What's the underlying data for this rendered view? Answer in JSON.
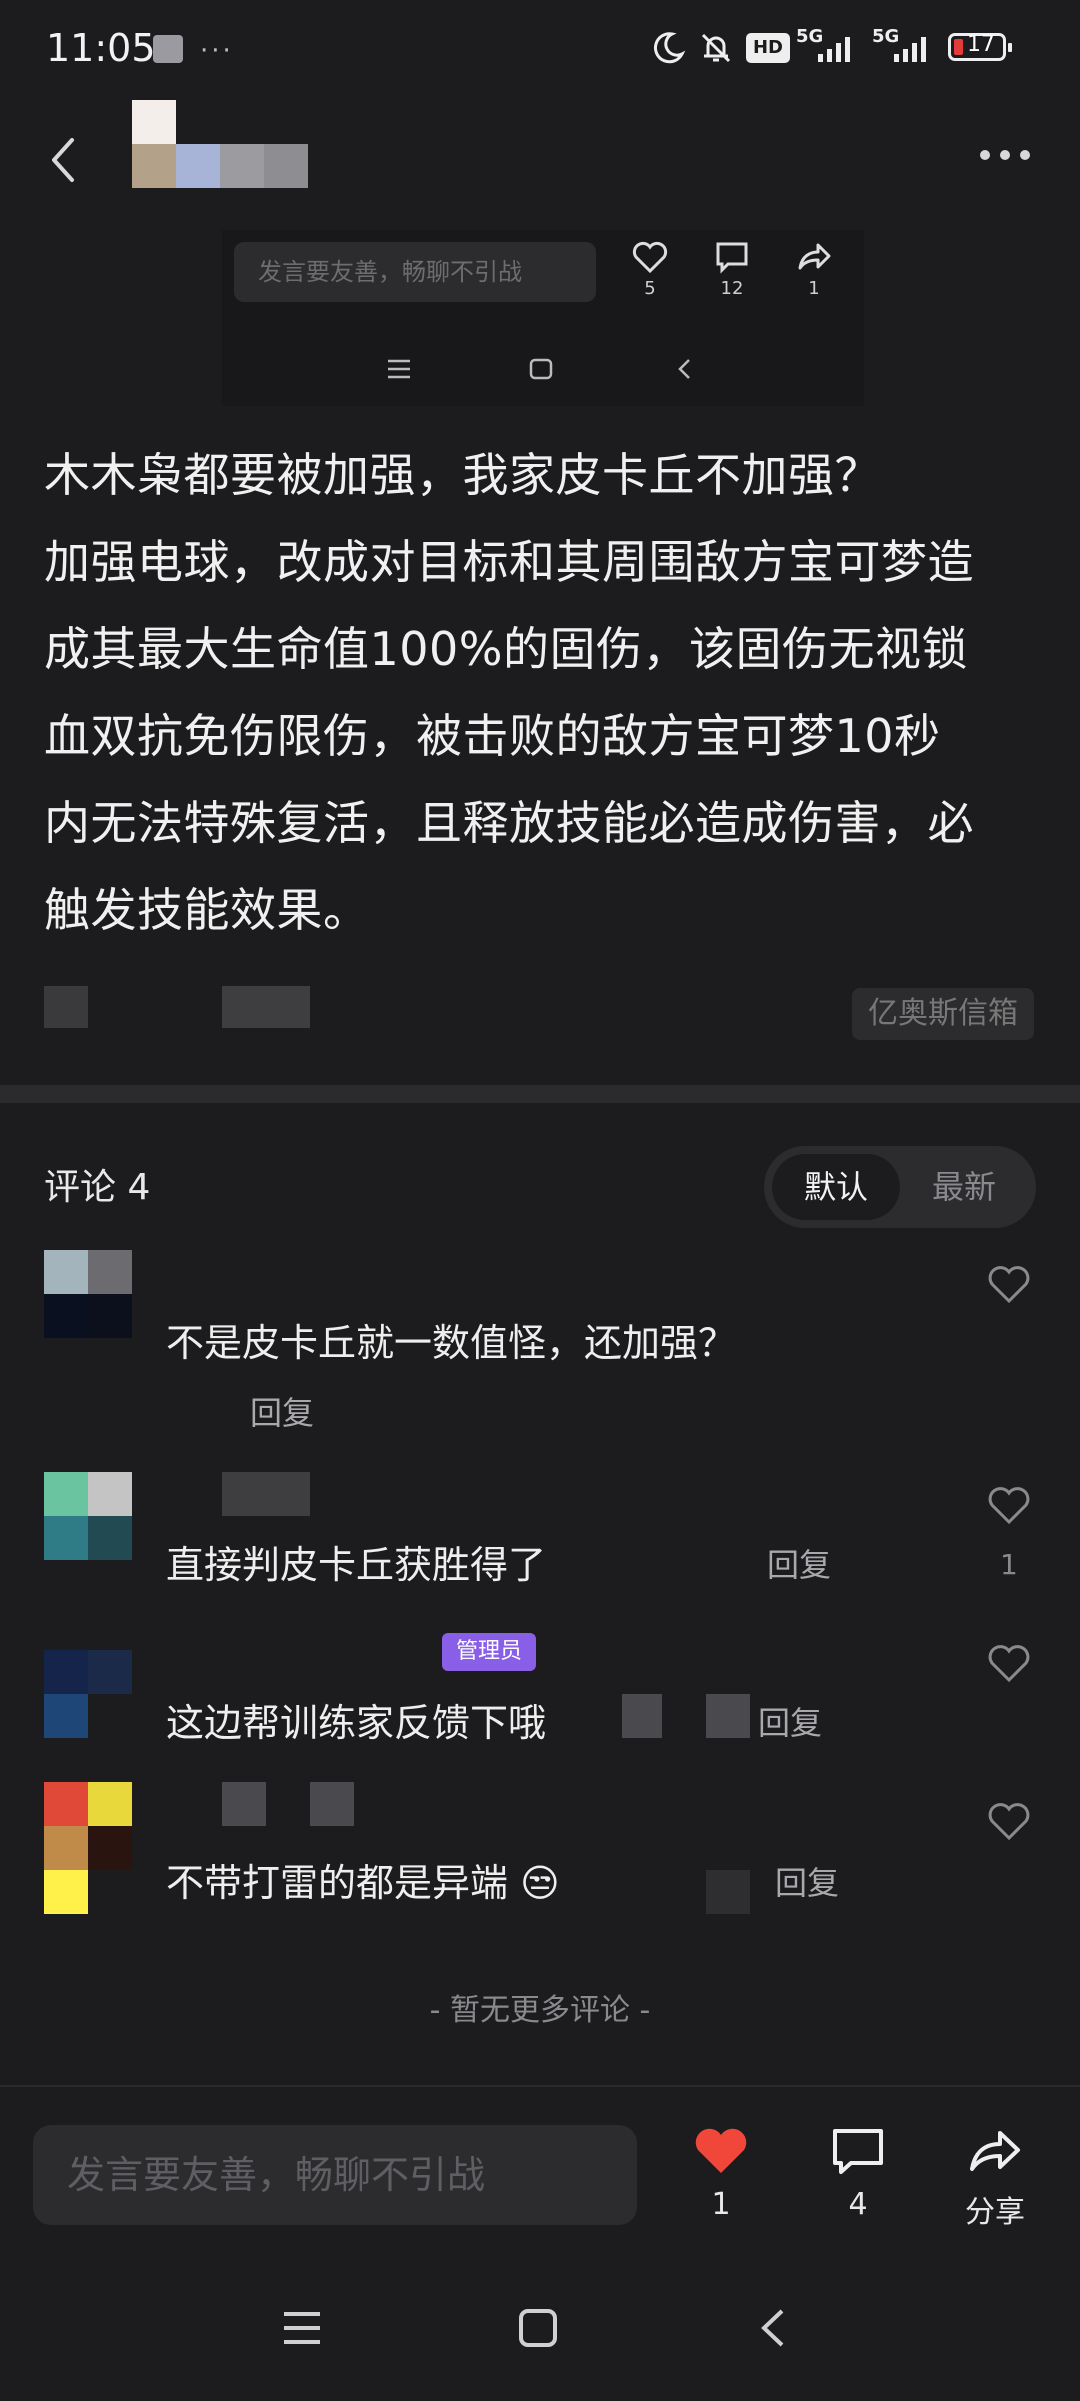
{
  "status_bar": {
    "time": "11:05",
    "icons": [
      "notification-app-icon",
      "more-dots-icon",
      "moon-icon",
      "bell-muted-icon",
      "hd-icon",
      "5g-signal-icon",
      "5g-signal-icon"
    ],
    "network_label_1": "5G",
    "network_label_2": "5G",
    "hd_label": "HD",
    "battery_level": "17"
  },
  "header": {
    "back_icon": "chevron-left-icon",
    "more_icon": "more-horizontal-icon"
  },
  "preview": {
    "input_placeholder": "发言要友善，畅聊不引战",
    "like_count": "5",
    "comment_count": "12",
    "share_count": "1"
  },
  "post": {
    "lines": [
      "木木枭都要被加强，我家皮卡丘不加强？",
      "加强电球，改成对目标和其周围敌方宝可梦造",
      "成其最大生命值100%的固伤，该固伤无视锁",
      "血双抗免伤限伤，被击败的敌方宝可梦10秒",
      "内无法特殊复活，且释放技能必造成伤害，必",
      "触发技能效果。"
    ],
    "source_tag": "亿奥斯信箱"
  },
  "comments_section": {
    "title": "评论 4",
    "sort_default": "默认",
    "sort_latest": "最新",
    "items": [
      {
        "text": "不是皮卡丘就一数值怪，还加强？",
        "reply": "回复",
        "likes": ""
      },
      {
        "text": "直接判皮卡丘获胜得了",
        "reply": "回复",
        "likes": "1"
      },
      {
        "text": "这边帮训练家反馈下哦",
        "reply": "回复",
        "likes": "",
        "badge": "管理员"
      },
      {
        "text": "不带打雷的都是异端",
        "reply": "回复",
        "likes": "",
        "emoji": "😒"
      }
    ],
    "no_more": "- 暂无更多评论 -"
  },
  "bottom_bar": {
    "input_placeholder": "发言要友善，畅聊不引战",
    "like_count": "1",
    "comment_count": "4",
    "share_label": "分享"
  },
  "colors": {
    "background": "#1c1c1e",
    "surface": "#2c2c2e",
    "like_red": "#f0473a",
    "admin_badge": "#8a5fe8"
  }
}
